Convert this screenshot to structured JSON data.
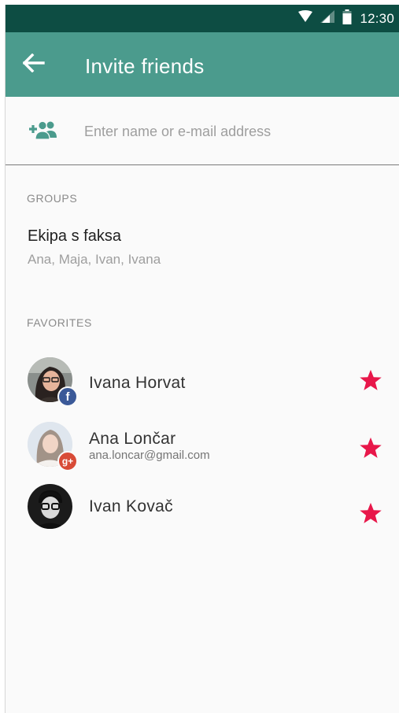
{
  "status_bar": {
    "time": "12:30",
    "icons": [
      "wifi-icon",
      "signal-icon",
      "battery-icon"
    ]
  },
  "toolbar": {
    "back_icon": "arrow-back-icon",
    "title": "Invite friends",
    "background_color": "#4b9b8d"
  },
  "search": {
    "icon": "add-person-icon",
    "value": "",
    "placeholder": "Enter name or e-mail address"
  },
  "groups": {
    "header": "GROUPS",
    "items": [
      {
        "name": "Ekipa s faksa",
        "members": "Ana, Maja, Ivan, Ivana"
      }
    ]
  },
  "favorites": {
    "header": "FAVORITES",
    "items": [
      {
        "name": "Ivana Horvat",
        "email": "",
        "source": "facebook",
        "badge_glyph": "f",
        "starred": true
      },
      {
        "name": "Ana Lončar",
        "email": "ana.loncar@gmail.com",
        "source": "google-plus",
        "badge_glyph": "g+",
        "starred": true
      },
      {
        "name": "Ivan Kovač",
        "email": "",
        "source": "",
        "badge_glyph": "",
        "starred": true
      }
    ]
  },
  "colors": {
    "status_bar": "#0d4d43",
    "accent": "#4b9b8d",
    "star": "#e8174a",
    "facebook": "#3b5998",
    "google_plus": "#d84b37"
  }
}
